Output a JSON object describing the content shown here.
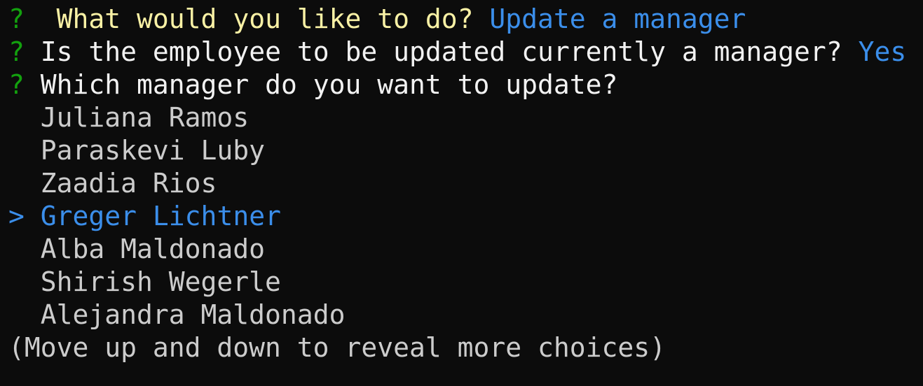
{
  "colors": {
    "background": "#0c0c0c",
    "question_mark": "#13a10e",
    "answer": "#3b8eea",
    "first_prompt": "#f9f1a5",
    "text": "#f2f2f2",
    "choice": "#cccccc"
  },
  "prompts": [
    {
      "marker": "?",
      "question": "What would you like to do?",
      "answer": "Update a manager"
    },
    {
      "marker": "?",
      "question": "Is the employee to be updated currently a manager?",
      "answer": "Yes"
    },
    {
      "marker": "?",
      "question": "Which manager do you want to update?"
    }
  ],
  "pointer": ">",
  "choices": [
    "Juliana Ramos",
    "Paraskevi Luby",
    "Zaadia Rios",
    "Greger Lichtner",
    "Alba Maldonado",
    "Shirish Wegerle",
    "Alejandra Maldonado"
  ],
  "selected_index": 3,
  "hint": "(Move up and down to reveal more choices)"
}
